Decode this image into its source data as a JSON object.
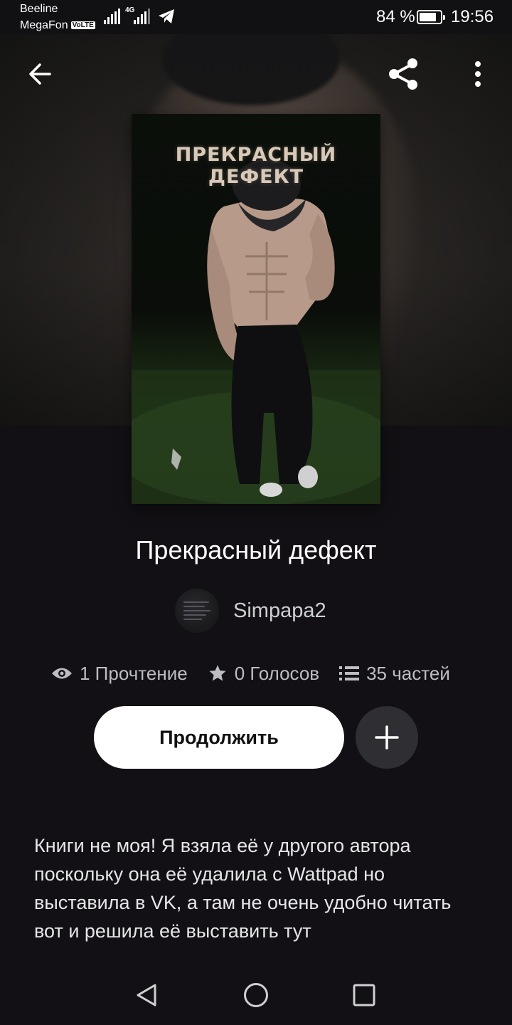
{
  "status_bar": {
    "carrier_1": "Beeline",
    "carrier_2": "MegaFon",
    "volte": "VoLTE",
    "network_type": "4G",
    "battery_percent": "84 %",
    "battery_level": 0.84,
    "time": "19:56"
  },
  "toolbar": {
    "back_icon": "arrow-left-icon",
    "share_icon": "share-icon",
    "more_icon": "more-vertical-icon"
  },
  "cover": {
    "title": "ПРЕКРАСНЫЙ ДЕФЕКТ"
  },
  "story": {
    "title": "Прекрасный дефект",
    "author": "Simpapa2",
    "reads": "1 Прочтение",
    "votes": "0 Голосов",
    "parts": "35 частей",
    "continue_label": "Продолжить",
    "description": "Книги не моя! Я взяла её у другого автора поскольку она её удалила с Wattpad но выставила в VK, а там не очень удобно читать вот и решила её выставить тут"
  },
  "colors": {
    "background": "#121014",
    "button_primary": "#ffffff",
    "button_secondary": "#2f2e32",
    "text_muted": "#bdbdc2"
  }
}
